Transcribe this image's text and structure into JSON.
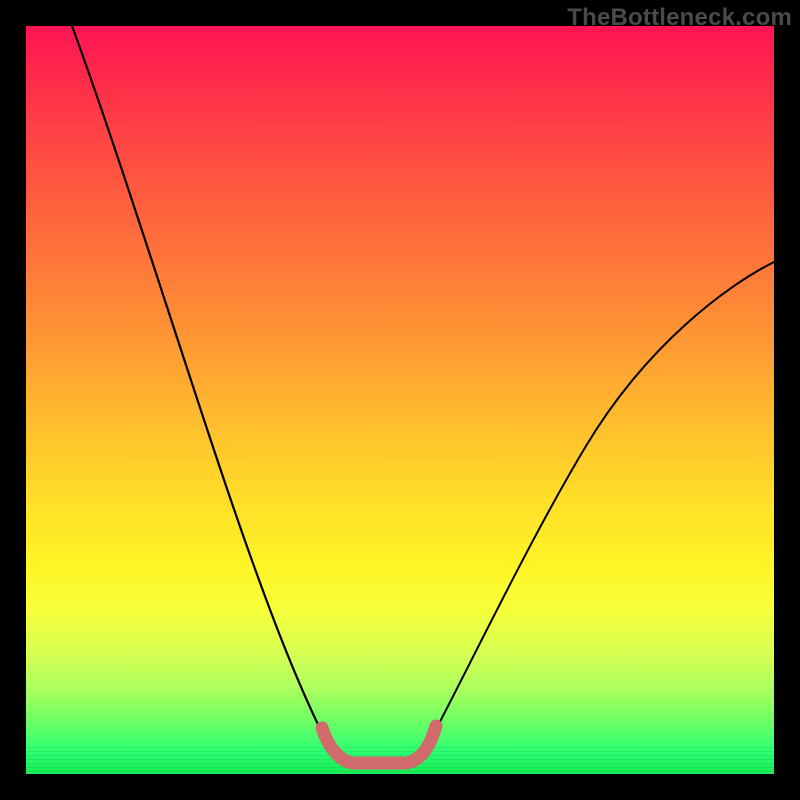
{
  "watermark": "TheBottleneck.com",
  "colors": {
    "frame": "#000000",
    "curve": "#000000",
    "marker": "#d16a6a",
    "gradient_top": "#ff1452",
    "gradient_mid": "#ffe028",
    "gradient_bottom": "#17ec58"
  },
  "chart_data": {
    "type": "line",
    "title": "",
    "xlabel": "",
    "ylabel": "",
    "xlim": [
      0,
      100
    ],
    "ylim": [
      0,
      100
    ],
    "series": [
      {
        "name": "left-descent",
        "x": [
          6,
          10,
          14,
          18,
          22,
          26,
          30,
          33,
          36,
          38,
          40,
          42
        ],
        "values": [
          100,
          86,
          73,
          60,
          48,
          37,
          27,
          19,
          13,
          8,
          4,
          2
        ]
      },
      {
        "name": "right-ascent",
        "x": [
          52,
          55,
          58,
          62,
          66,
          70,
          75,
          80,
          86,
          92,
          100
        ],
        "values": [
          2,
          5,
          9,
          15,
          22,
          29,
          37,
          45,
          53,
          60,
          68
        ]
      },
      {
        "name": "bottleneck-marker",
        "x": [
          40,
          42,
          44,
          46,
          48,
          50,
          52,
          54
        ],
        "values": [
          5,
          2,
          1,
          1,
          1,
          1,
          2,
          5
        ]
      }
    ],
    "annotations": []
  }
}
